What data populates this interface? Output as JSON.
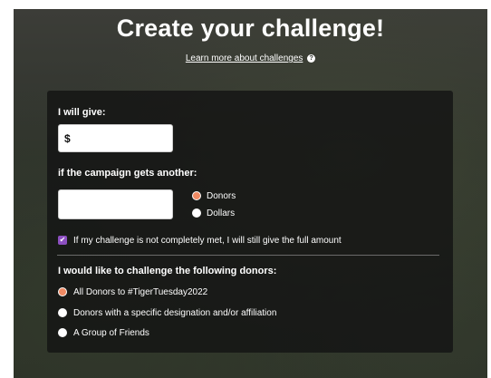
{
  "title": "Create your challenge!",
  "learn_more_link": "Learn more about challenges",
  "help_icon": "question-circle-icon",
  "form": {
    "give_label": "I will give:",
    "amount_prefix": "$",
    "amount_value": "",
    "campaign_label": "if the campaign gets another:",
    "target_value": "",
    "unit_options": [
      {
        "label": "Donors",
        "selected": true
      },
      {
        "label": "Dollars",
        "selected": false
      }
    ],
    "full_amount_checkbox": {
      "checked": true,
      "label": "If my challenge is not completely met, I will still give the full amount"
    },
    "challenge_label": "I would like to challenge the following donors:",
    "donor_options": [
      {
        "label": "All Donors to #TigerTuesday2022",
        "selected": true
      },
      {
        "label": "Donors with a specific designation and/or affiliation",
        "selected": false
      },
      {
        "label": "A Group of Friends",
        "selected": false
      }
    ]
  },
  "colors": {
    "accent_radio": "#f08a63",
    "checkbox": "#8c4fc0",
    "card_bg": "#141414"
  }
}
